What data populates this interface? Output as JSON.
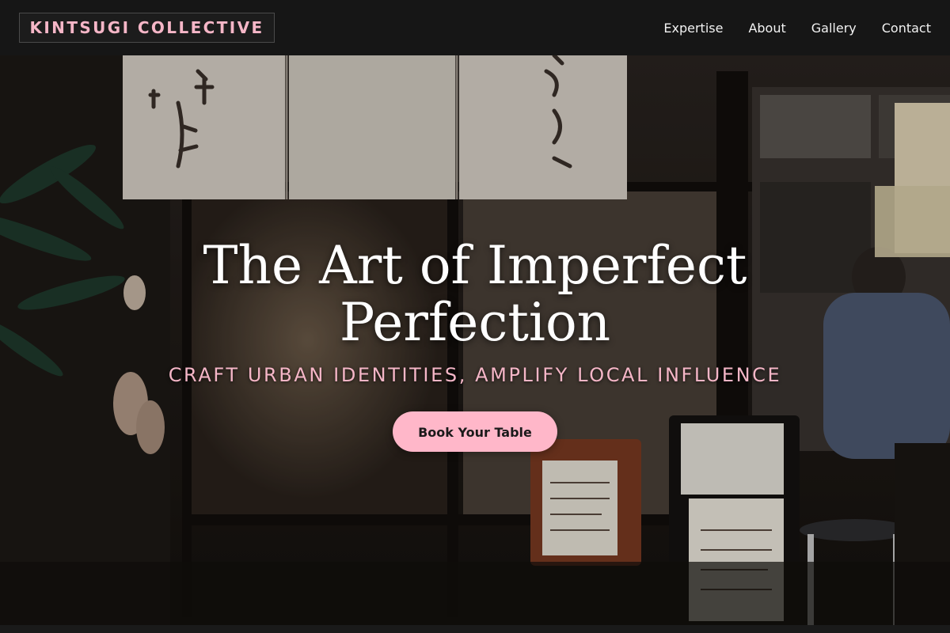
{
  "nav": {
    "brand": "KINTSUGI COLLECTIVE",
    "links": [
      {
        "label": "Expertise"
      },
      {
        "label": "About"
      },
      {
        "label": "Gallery"
      },
      {
        "label": "Contact"
      }
    ]
  },
  "hero": {
    "headline_line1": "The Art of Imperfect",
    "headline_line2": "Perfection",
    "tagline": "CRAFT URBAN IDENTITIES, AMPLIFY LOCAL INFLUENCE",
    "cta_label": "Book Your Table"
  },
  "colors": {
    "accent_pink": "#f5b6c7",
    "button_pink": "#ffb7c9",
    "nav_bg": "#161616"
  }
}
